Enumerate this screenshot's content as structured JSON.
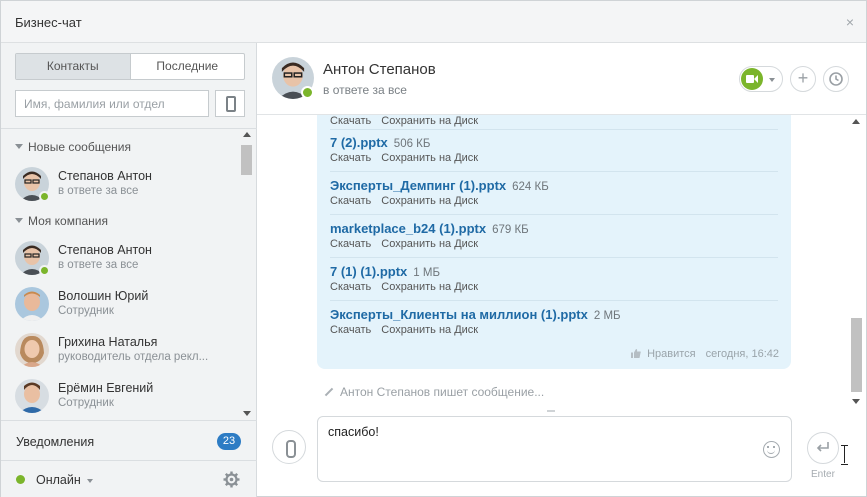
{
  "window": {
    "title": "Бизнес-чат",
    "close_label": "×"
  },
  "sidebar": {
    "tabs": [
      {
        "label": "Контакты",
        "active": true
      },
      {
        "label": "Последние",
        "active": false
      }
    ],
    "search": {
      "placeholder": "Имя, фамилия или отдел",
      "value": ""
    },
    "groups": [
      {
        "label": "Новые сообщения"
      },
      {
        "label": "Моя компания"
      }
    ],
    "contacts": [
      {
        "name": "Степанов Антон",
        "status": "в ответе за все",
        "online": true
      },
      {
        "name": "Степанов Антон",
        "status": "в ответе за все",
        "online": true
      },
      {
        "name": "Волошин Юрий",
        "status": "Сотрудник",
        "online": false
      },
      {
        "name": "Грихина Наталья",
        "status": "руководитель отдела рекл...",
        "online": false
      },
      {
        "name": "Ерёмин Евгений",
        "status": "Сотрудник",
        "online": false
      }
    ],
    "notifications": {
      "label": "Уведомления",
      "count": "23"
    },
    "user_status": {
      "label": "Онлайн"
    }
  },
  "chat": {
    "header": {
      "name": "Антон Степанов",
      "subtitle": "в ответе за все"
    },
    "partial_actions": {
      "download": "Скачать",
      "save": "Сохранить на Диск"
    },
    "files": [
      {
        "name": "7 (2).pptx",
        "size": "506 КБ",
        "download": "Скачать",
        "save": "Сохранить на Диск"
      },
      {
        "name": "Эксперты_Демпинг (1).pptx",
        "size": "624 КБ",
        "download": "Скачать",
        "save": "Сохранить на Диск"
      },
      {
        "name": "marketplace_b24 (1).pptx",
        "size": "679 КБ",
        "download": "Скачать",
        "save": "Сохранить на Диск"
      },
      {
        "name": "7 (1) (1).pptx",
        "size": "1 МБ",
        "download": "Скачать",
        "save": "Сохранить на Диск"
      },
      {
        "name": "Эксперты_Клиенты на миллион (1).pptx",
        "size": "2 МБ",
        "download": "Скачать",
        "save": "Сохранить на Диск"
      }
    ],
    "message_meta": {
      "like": "Нравится",
      "time": "сегодня, 16:42"
    },
    "typing": "Антон Степанов пишет сообщение...",
    "input": {
      "value": "спасибо!"
    },
    "send_hint": "Enter",
    "colors": {
      "accent": "#2d7cc4",
      "online": "#7bb52b",
      "bubble": "#e4f3fb",
      "file_link": "#1f6aa5"
    }
  }
}
